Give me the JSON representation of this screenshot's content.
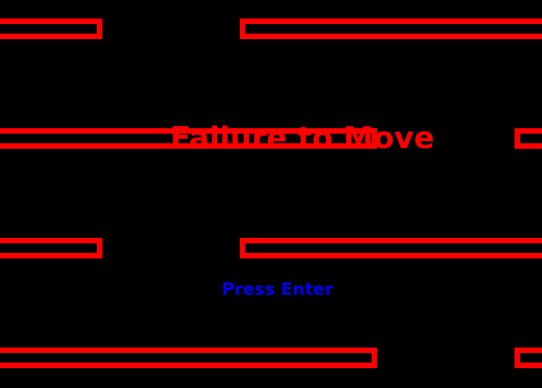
{
  "screen": {
    "title": "Failure to Move",
    "prompt": "Press Enter"
  },
  "colors": {
    "background": "#000000",
    "platform": "#ff0000",
    "title": "#ff0000",
    "prompt": "#0000ee"
  }
}
